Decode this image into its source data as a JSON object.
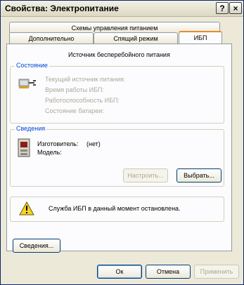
{
  "window": {
    "title": "Свойства: Электропитание",
    "help_button": "?",
    "close_button": "×"
  },
  "tabs": {
    "row1": [
      "Схемы управления питанием"
    ],
    "row2": [
      "Дополнительно",
      "Спящий режим",
      "ИБП"
    ]
  },
  "panel": {
    "heading": "Источник бесперебойного питания",
    "status": {
      "legend": "Состояние",
      "rows": [
        "Текущий источник питания:",
        "Время работы ИБП:",
        "Работоспособность ИБП:",
        "Состояние батареи:"
      ]
    },
    "details": {
      "legend": "Сведения",
      "manufacturer_label": "Изготовитель:",
      "manufacturer_value": "(нет)",
      "model_label": "Модель:",
      "configure_button": "Настроить...",
      "select_button": "Выбрать..."
    },
    "service_message": "Служба ИБП в данный момент остановлена.",
    "info_button": "Сведения..."
  },
  "footer": {
    "ok": "Ок",
    "cancel": "Отмена",
    "apply": "Применить"
  }
}
